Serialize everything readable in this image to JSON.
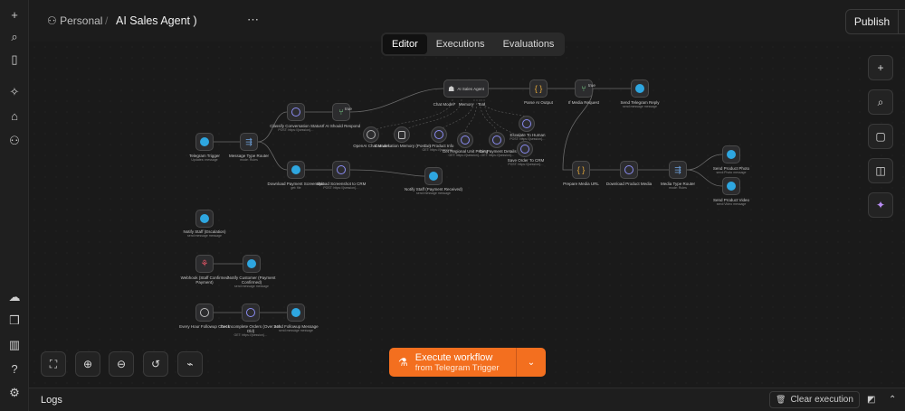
{
  "breadcrumb": {
    "workspace": "Personal",
    "workflow": "AI Sales Agent )",
    "more": "⋯"
  },
  "header": {
    "publish_label": "Publish"
  },
  "view_tabs": [
    "Editor",
    "Executions",
    "Evaluations"
  ],
  "execute": {
    "label": "Execute workflow",
    "sublabel": "from Telegram Trigger"
  },
  "logs": {
    "title": "Logs",
    "clear_label": "Clear execution"
  },
  "nodes": {
    "telegram_trigger": {
      "title": "Telegram Trigger",
      "sub": "Updates: message"
    },
    "message_type_router": {
      "title": "Message Type Router",
      "sub": "mode: Rules"
    },
    "classify_conversation": {
      "title": "Classify Conversation Status",
      "sub": "POST: https://{session}…"
    },
    "if_ai_should_respond": {
      "title": "If AI Should Respond",
      "sub": ""
    },
    "ai_sales_agent": {
      "title": "AI Sales Agent",
      "sub": ""
    },
    "parse_ai_output": {
      "title": "Parse AI Output",
      "sub": ""
    },
    "if_media_request": {
      "title": "If Media Request",
      "sub": ""
    },
    "send_telegram_reply": {
      "title": "Send Telegram Reply",
      "sub": "send:message message"
    },
    "openai_chat_model": {
      "title": "OpenAI Chat Model",
      "sub": ""
    },
    "conversation_memory": {
      "title": "Conversation Memory (Post…)",
      "sub": ""
    },
    "get_product_info": {
      "title": "Get Product Info",
      "sub": "GET: https://{session}…"
    },
    "get_regional_pricing": {
      "title": "Get Regional Unit Pricing",
      "sub": "GET: https://{session}…"
    },
    "get_payment_details": {
      "title": "Get Payment Details",
      "sub": "GET: https://{session}…"
    },
    "escalate_to_human": {
      "title": "Escalate To Human",
      "sub": "POST: https://{session}…"
    },
    "save_order_to_crm": {
      "title": "Save Order To CRM",
      "sub": "POST: https://{session}…"
    },
    "download_payment_screenshot": {
      "title": "Download Payment Screenshot",
      "sub": "get: file"
    },
    "upload_screenshot_to_crm": {
      "title": "Upload Screenshot to CRM",
      "sub": "POST: https://{session}…"
    },
    "notify_staff_payment": {
      "title": "Notify Staff (Payment Received)",
      "sub": "send:message message"
    },
    "prepare_media_url": {
      "title": "Prepare Media URL",
      "sub": ""
    },
    "download_product_media": {
      "title": "Download Product Media",
      "sub": ""
    },
    "media_type_router": {
      "title": "Media Type Router",
      "sub": "mode: Rules"
    },
    "send_product_photo": {
      "title": "Send Product Photo",
      "sub": "send:Photo message"
    },
    "send_product_video": {
      "title": "Send Product Video",
      "sub": "send:Video message"
    },
    "notify_staff_escalation": {
      "title": "Notify Staff (Escalation)",
      "sub": "send:message message"
    },
    "webhook_staff_confirmed": {
      "title": "Webhook (Staff Confirmed Payment)",
      "sub": ""
    },
    "notify_customer_payment": {
      "title": "Notify Customer (Payment Confirmed)",
      "sub": "send:message message"
    },
    "every_hour_followup": {
      "title": "Every Hour Followup Check",
      "sub": ""
    },
    "get_incomplete_orders": {
      "title": "Get Incomplete Orders (Over 24h Old)",
      "sub": "GET: https://{session}…"
    },
    "send_followup": {
      "title": "Send Followup Message",
      "sub": "send:message message"
    }
  },
  "edge_labels": {
    "true1": "true",
    "true2": "true",
    "chat_model": "Chat Model*",
    "memory": "Memory",
    "tool": "Tool"
  }
}
